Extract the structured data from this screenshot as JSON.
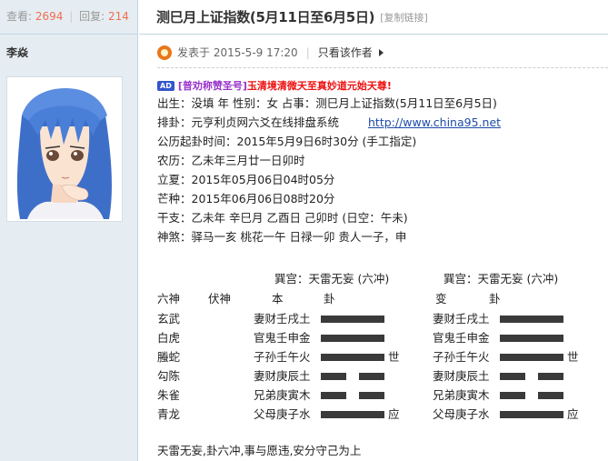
{
  "sidebar": {
    "views_label": "查看:",
    "views": "2694",
    "sep": "|",
    "replies_label": "回复:",
    "replies": "214",
    "author": "李焱"
  },
  "thread": {
    "title": "测巳月上证指数(5月11日至6月5日)",
    "copy_link": "[复制链接]"
  },
  "post_meta": {
    "posted": "发表于 2015-5-9 17:20",
    "pipe": "|",
    "author_only": "只看该作者"
  },
  "ad": {
    "badge": "AD",
    "text_purple": "[普劝称赞圣号]",
    "text_red": "玉清境清微天至真妙道元始天尊!"
  },
  "content": {
    "line1": "出生：没填 年   性别：女   占事：测巳月上证指数(5月11日至6月5日)",
    "line2_text": "排卦：元亨利贞网六爻在线排盘系统",
    "line2_url": "http://www.china95.net",
    "line3": "公历起卦时间：2015年5月9日6时30分    (手工指定)",
    "line4": "农历：乙未年三月廿一日卯时",
    "line5": "立夏：2015年05月06日04时05分",
    "line6": "芒种：2015年06月06日08时20分",
    "line7": "干支：乙未年   辛巳月   乙酉日   己卯时       (日空：午未)",
    "line8": "神煞：驿马一亥   桃花一午   日禄一卯   贵人一子，申"
  },
  "gua": {
    "left_title": "巽宫：天雷无妄 (六冲)",
    "right_title": "巽宫：天雷无妄 (六冲)",
    "header_liushen": "六神",
    "header_fushen": "伏神",
    "header_ben": "本",
    "header_gua": "卦",
    "header_bian": "变",
    "header_gua2": "卦",
    "rows": [
      {
        "shen": "玄武",
        "ben": "妻财壬戌土",
        "ben_yao": "yang",
        "ben_mark": "",
        "bian": "妻财壬戌土",
        "bian_yao": "yang",
        "bian_mark": ""
      },
      {
        "shen": "白虎",
        "ben": "官鬼壬申金",
        "ben_yao": "yang",
        "ben_mark": "",
        "bian": "官鬼壬申金",
        "bian_yao": "yang",
        "bian_mark": ""
      },
      {
        "shen": "螣蛇",
        "ben": "子孙壬午火",
        "ben_yao": "yang",
        "ben_mark": "世",
        "bian": "子孙壬午火",
        "bian_yao": "yang",
        "bian_mark": "世"
      },
      {
        "shen": "勾陈",
        "ben": "妻财庚辰土",
        "ben_yao": "yin",
        "ben_mark": "",
        "bian": "妻财庚辰土",
        "bian_yao": "yin",
        "bian_mark": ""
      },
      {
        "shen": "朱雀",
        "ben": "兄弟庚寅木",
        "ben_yao": "yin",
        "ben_mark": "",
        "bian": "兄弟庚寅木",
        "bian_yao": "yin",
        "bian_mark": ""
      },
      {
        "shen": "青龙",
        "ben": "父母庚子水",
        "ben_yao": "yang",
        "ben_mark": "应",
        "bian": "父母庚子水",
        "bian_yao": "yang",
        "bian_mark": "应"
      }
    ],
    "summary": "天雷无妄,卦六冲,事与愿违,安分守己为上"
  },
  "colors": {
    "sidebar_bg": "#e5edf2",
    "border": "#c2d5e3",
    "count": "#f26c4f",
    "link": "#1e4ba8",
    "ad_red": "#ee1111",
    "ad_purple": "#9933cc"
  },
  "icons": {
    "online": "online-status-icon",
    "triangle": "triangle-right-icon",
    "ad": "ad-badge-icon"
  }
}
